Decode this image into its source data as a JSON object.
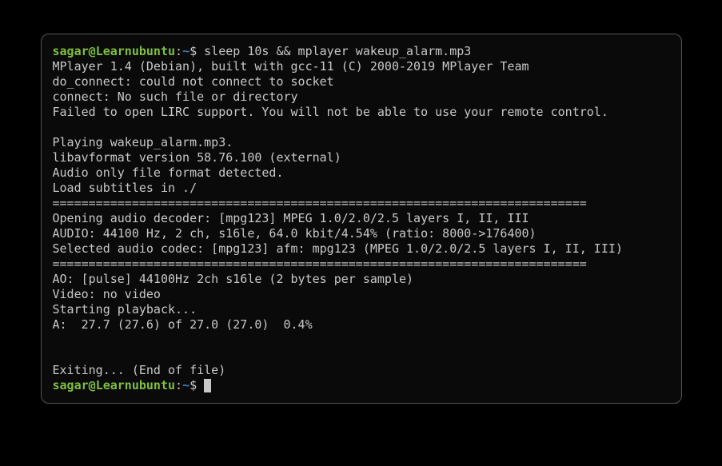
{
  "prompt1": {
    "user": "sagar",
    "at": "@",
    "host": "Learnubuntu",
    "sep1": ":",
    "path": "~",
    "dollar": "$ ",
    "command": "sleep 10s && mplayer wakeup_alarm.mp3"
  },
  "output_lines": [
    "MPlayer 1.4 (Debian), built with gcc-11 (C) 2000-2019 MPlayer Team",
    "do_connect: could not connect to socket",
    "connect: No such file or directory",
    "Failed to open LIRC support. You will not be able to use your remote control.",
    "",
    "Playing wakeup_alarm.mp3.",
    "libavformat version 58.76.100 (external)",
    "Audio only file format detected.",
    "Load subtitles in ./",
    "==========================================================================",
    "Opening audio decoder: [mpg123] MPEG 1.0/2.0/2.5 layers I, II, III",
    "AUDIO: 44100 Hz, 2 ch, s16le, 64.0 kbit/4.54% (ratio: 8000->176400)",
    "Selected audio codec: [mpg123] afm: mpg123 (MPEG 1.0/2.0/2.5 layers I, II, III)",
    "==========================================================================",
    "AO: [pulse] 44100Hz 2ch s16le (2 bytes per sample)",
    "Video: no video",
    "Starting playback...",
    "A:  27.7 (27.6) of 27.0 (27.0)  0.4%",
    "",
    "",
    "Exiting... (End of file)"
  ],
  "prompt2": {
    "user": "sagar",
    "at": "@",
    "host": "Learnubuntu",
    "sep1": ":",
    "path": "~",
    "dollar": "$ "
  }
}
